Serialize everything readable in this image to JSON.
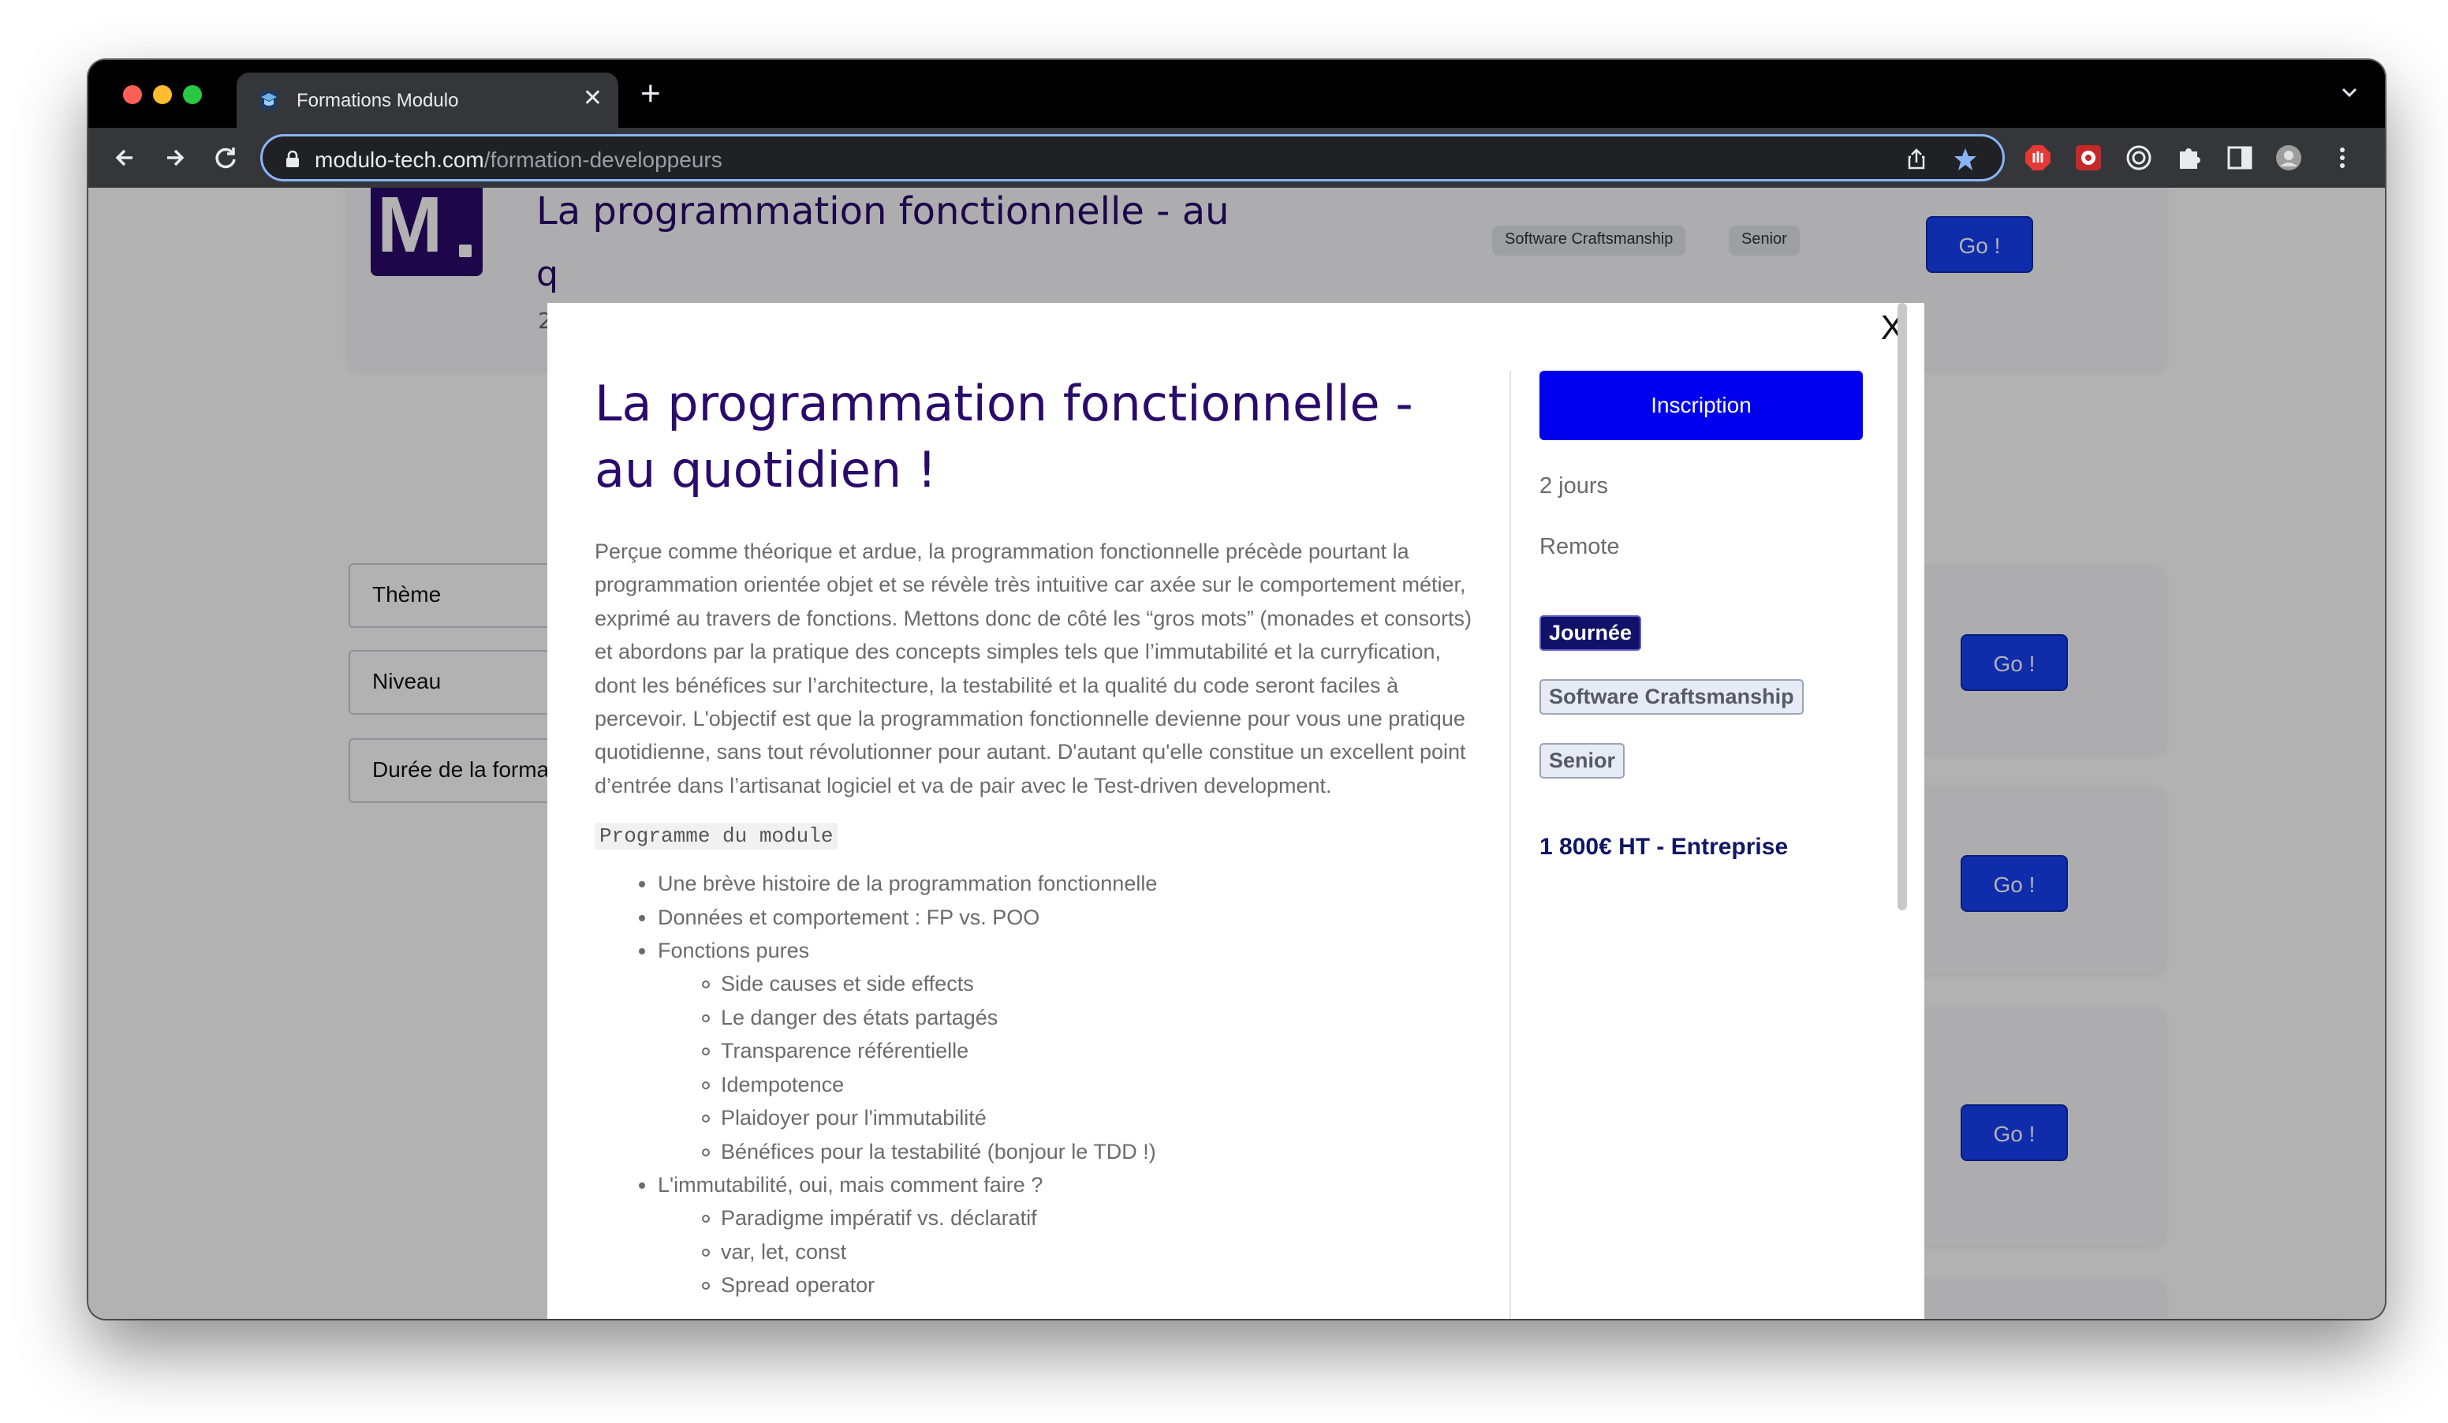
{
  "browser": {
    "tab_title": "Formations Modulo",
    "tab_close": "✕",
    "new_tab": "+",
    "url_host": "modulo-tech.com",
    "url_path": "/formation-developpeurs"
  },
  "background": {
    "logo_text": "M",
    "card_title": "La programmation fonctionnelle - au",
    "card_title_fragment": "q",
    "card_meta_fragment": "2",
    "tags": [
      "Software Craftsmanship",
      "Senior"
    ],
    "go_label": "Go !",
    "filters": [
      "Thème",
      "Niveau",
      "Durée de la formation"
    ]
  },
  "modal": {
    "close_label": "X",
    "title": "La programmation fonctionnelle - au quotidien !",
    "description": "Perçue comme théorique et ardue, la programmation fonctionnelle précède pourtant la programmation orientée objet et se révèle très intuitive car axée sur le comportement métier, exprimé au travers de fonctions. Mettons donc de côté les “gros mots” (monades et consorts) et abordons par la pratique des concepts simples tels que l’immutabilité et la curryfication, dont les bénéfices sur l’architecture, la testabilité et la qualité du code seront faciles à percevoir. L'objectif est que la programmation fonctionnelle devienne pour vous une pratique quotidienne, sans tout révolutionner pour autant. D'autant qu'elle constitue un excellent point d’entrée dans l’artisanat logiciel et va de pair avec le Test-driven development.",
    "program_label": "Programme du module",
    "program": [
      {
        "level": 1,
        "text": "Une brève histoire de la programmation fonctionnelle"
      },
      {
        "level": 1,
        "text": "Données et comportement : FP vs. POO"
      },
      {
        "level": 1,
        "text": "Fonctions pures"
      },
      {
        "level": 2,
        "text": "Side causes et side effects"
      },
      {
        "level": 2,
        "text": "Le danger des états partagés"
      },
      {
        "level": 2,
        "text": "Transparence référentielle"
      },
      {
        "level": 2,
        "text": "Idempotence"
      },
      {
        "level": 2,
        "text": "Plaidoyer pour l'immutabilité"
      },
      {
        "level": 2,
        "text": "Bénéfices pour la testabilité (bonjour le TDD !)"
      },
      {
        "level": 1,
        "text": "L'immutabilité, oui, mais comment faire ?"
      },
      {
        "level": 2,
        "text": "Paradigme impératif vs. déclaratif"
      },
      {
        "level": 2,
        "text": "var, let, const"
      },
      {
        "level": 2,
        "text": "Spread operator"
      }
    ],
    "inscription_label": "Inscription",
    "duration": "2 jours",
    "location": "Remote",
    "badges": {
      "format": "Journée",
      "theme": "Software Craftsmanship",
      "level": "Senior"
    },
    "price": "1 800€ HT - Entreprise"
  },
  "colors": {
    "brand": "#2a0a6b",
    "primary_button": "#0000ee",
    "go_button": "#1640f5"
  }
}
